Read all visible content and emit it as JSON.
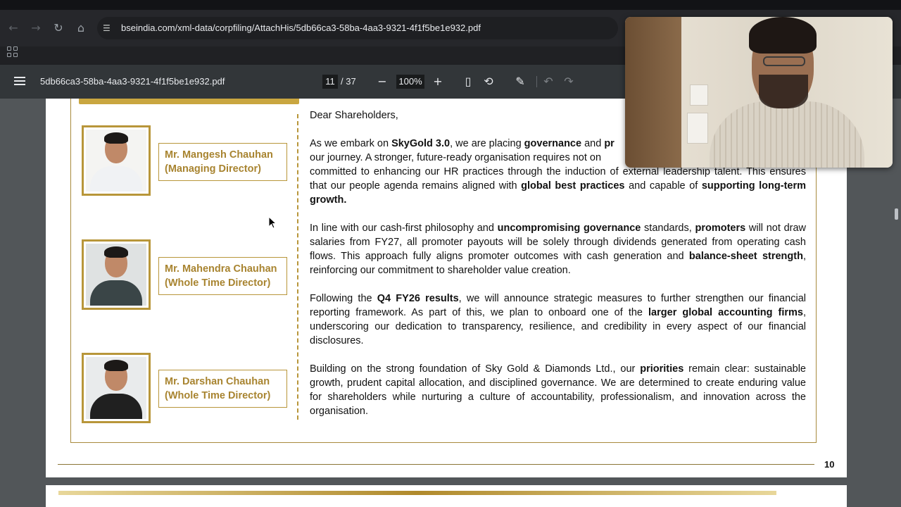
{
  "browser": {
    "url": "bseindia.com/xml-data/corpfiling/AttachHis/5db66ca3-58ba-4aa3-9321-4f1f5be1e932.pdf"
  },
  "pdf_toolbar": {
    "filename": "5db66ca3-58ba-4aa3-9321-4f1f5be1e932.pdf",
    "current_page": "11",
    "total_pages": "/ 37",
    "zoom": "100%"
  },
  "directors": [
    {
      "name": "Mr. Mangesh Chauhan",
      "role": "(Managing Director)"
    },
    {
      "name": "Mr. Mahendra Chauhan",
      "role": "(Whole Time Director)"
    },
    {
      "name": "Mr. Darshan Chauhan",
      "role": "(Whole Time Director)"
    }
  ],
  "letter": {
    "salutation": "Dear Shareholders,",
    "p1": [
      "As we embark on ",
      "SkyGold 3.0",
      ", we are placing ",
      "governance",
      " and ",
      "pr",
      "our journey. A stronger, future-ready organisation requires not on",
      "committed to enhancing our HR practices through the induction of external leadership talent. This ensures that our people agenda remains aligned with ",
      "global best practices",
      " and capable of ",
      "supporting long-term growth."
    ],
    "p2": [
      "In line with our cash-first philosophy and ",
      "uncompromising governance",
      " standards, ",
      "promoters",
      " will not draw salaries from FY27, all promoter payouts will be solely through dividends generated from operating cash flows. This approach fully aligns promoter outcomes with cash generation and ",
      "balance-sheet strength",
      ", reinforcing our commitment to shareholder value creation."
    ],
    "p3": [
      "Following the ",
      "Q4 FY26 results",
      ", we will announce strategic measures to further strengthen our financial reporting framework. As part of this, we plan to onboard one of the ",
      "larger global accounting firms",
      ", underscoring our dedication to transparency, resilience, and credibility in every aspect of our financial disclosures."
    ],
    "p4": [
      "Building on the strong foundation of Sky Gold & Diamonds Ltd., our ",
      "priorities",
      " remain clear: sustainable growth, prudent capital allocation, and disciplined governance. We are determined to create enduring value for shareholders while nurturing a culture of accountability, professionalism, and innovation across the organisation."
    ]
  },
  "page_number": "10",
  "colors": {
    "gold": "#b8963a",
    "gold_text": "#a88430",
    "viewer_bg": "#525659",
    "toolbar_bg": "#323639"
  },
  "icons": [
    "back-icon",
    "forward-icon",
    "reload-icon",
    "home-icon",
    "site-info-icon",
    "apps-icon",
    "menu-icon",
    "zoom-out-icon",
    "zoom-in-icon",
    "fit-page-icon",
    "rotate-icon",
    "annotate-icon",
    "undo-icon",
    "redo-icon"
  ]
}
